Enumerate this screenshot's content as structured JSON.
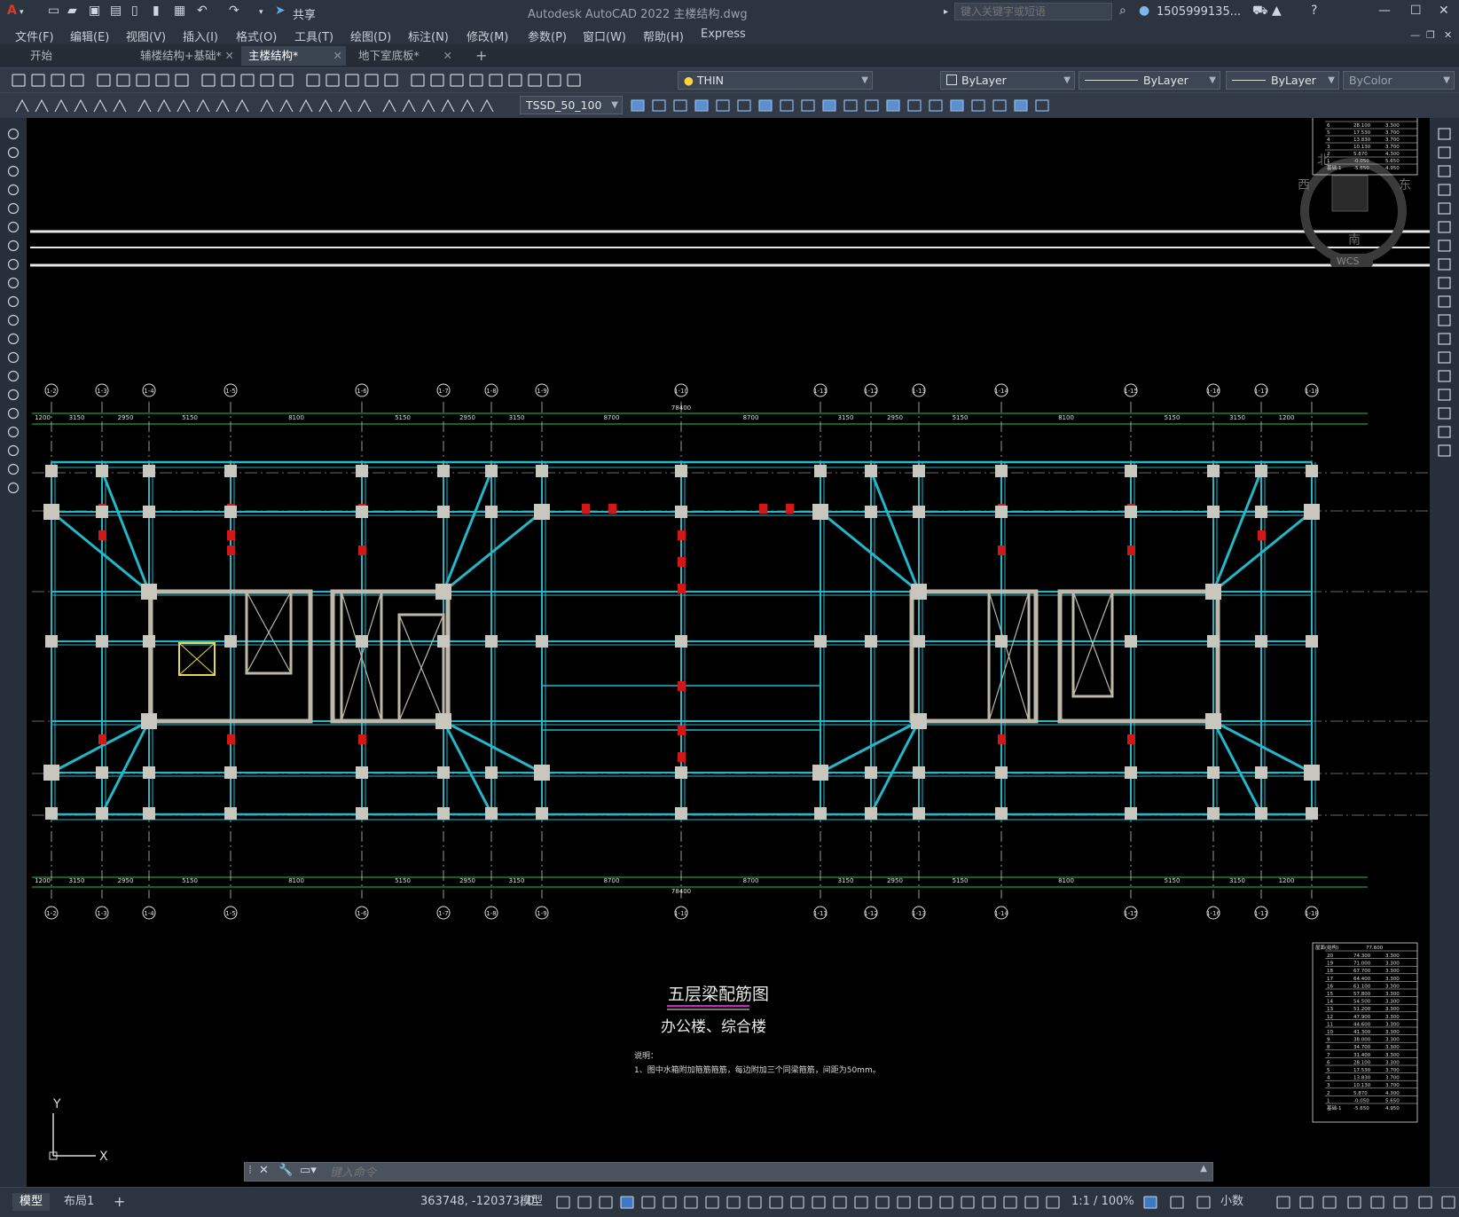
{
  "titlebar": {
    "app_title": "Autodesk AutoCAD 2022    主楼结构.dwg",
    "share_label": "共享",
    "search_placeholder": "键入关键字或短语",
    "user_name": "1505999135..."
  },
  "menu": [
    "文件(F)",
    "编辑(E)",
    "视图(V)",
    "插入(I)",
    "格式(O)",
    "工具(T)",
    "绘图(D)",
    "标注(N)",
    "修改(M)",
    "参数(P)",
    "窗口(W)",
    "帮助(H)",
    "Express"
  ],
  "tabs": [
    {
      "label": "开始",
      "active": false,
      "modified": false
    },
    {
      "label": "辅楼结构+基础*",
      "active": false
    },
    {
      "label": "主楼结构*",
      "active": true
    },
    {
      "label": "地下室底板*",
      "active": false
    }
  ],
  "toolbar": {
    "layer_name": "THIN",
    "color": "ByLayer",
    "linetype": "ByLayer",
    "lineweight": "ByLayer",
    "plotstyle": "ByColor",
    "dimstyle": "TSSD_50_100"
  },
  "drawing": {
    "title": "五层梁配筋图",
    "subtitle": "办公楼、综合楼",
    "note_heading": "说明：",
    "note_line": "1、图中水箱附加箍筋箍筋，每边附加三个同梁箍筋，间距为50mm。",
    "viewcube": {
      "north": "北",
      "east": "东",
      "west": "西",
      "south": "南",
      "wcs": "WCS"
    },
    "ucs": {
      "x": "X",
      "y": "Y"
    },
    "grid_labels": [
      "1-2",
      "1-3",
      "1-4",
      "1-5",
      "1-6",
      "1-7",
      "1-8",
      "1-9",
      "1-10",
      "1-11",
      "1-12",
      "1-13",
      "1-14",
      "1-15",
      "1-16",
      "1-17",
      "1-18"
    ],
    "dims_top": [
      "1200",
      "3150",
      "2950",
      "5150",
      "8100",
      "5150",
      "2950",
      "3150",
      "8700",
      "8700",
      "3150",
      "2950",
      "5150",
      "8100",
      "5150",
      "3150",
      "1200"
    ],
    "total_dim": "78400",
    "level_table": {
      "header": "屋面(结构)",
      "rows": [
        [
          "20",
          "74.300",
          "3.300"
        ],
        [
          "19",
          "71.000",
          "3.300"
        ],
        [
          "18",
          "67.700",
          "3.300"
        ],
        [
          "17",
          "64.400",
          "3.300"
        ],
        [
          "16",
          "61.100",
          "3.300"
        ],
        [
          "15",
          "57.800",
          "3.300"
        ],
        [
          "14",
          "54.500",
          "3.300"
        ],
        [
          "13",
          "51.200",
          "3.300"
        ],
        [
          "12",
          "47.900",
          "3.300"
        ],
        [
          "11",
          "44.600",
          "3.300"
        ],
        [
          "10",
          "41.300",
          "3.300"
        ],
        [
          "9",
          "38.000",
          "3.300"
        ],
        [
          "8",
          "34.700",
          "3.300"
        ],
        [
          "7",
          "31.400",
          "3.300"
        ],
        [
          "6",
          "28.100",
          "3.300"
        ],
        [
          "5",
          "17.530",
          "3.700"
        ],
        [
          "4",
          "13.830",
          "3.700"
        ],
        [
          "3",
          "10.130",
          "3.700"
        ],
        [
          "2",
          "5.870",
          "4.300"
        ],
        [
          "1",
          "-0.050",
          "5.650"
        ],
        [
          "基础-1",
          "-5.650",
          "4.950"
        ]
      ],
      "roof_level": "77.600"
    }
  },
  "command": {
    "placeholder": "键入命令"
  },
  "status": {
    "tab_model": "模型",
    "tab_layout": "布局1",
    "coords": "363748, -120373, 0",
    "mode": "模型",
    "scale": "1:1 / 100%",
    "units": "小数"
  }
}
